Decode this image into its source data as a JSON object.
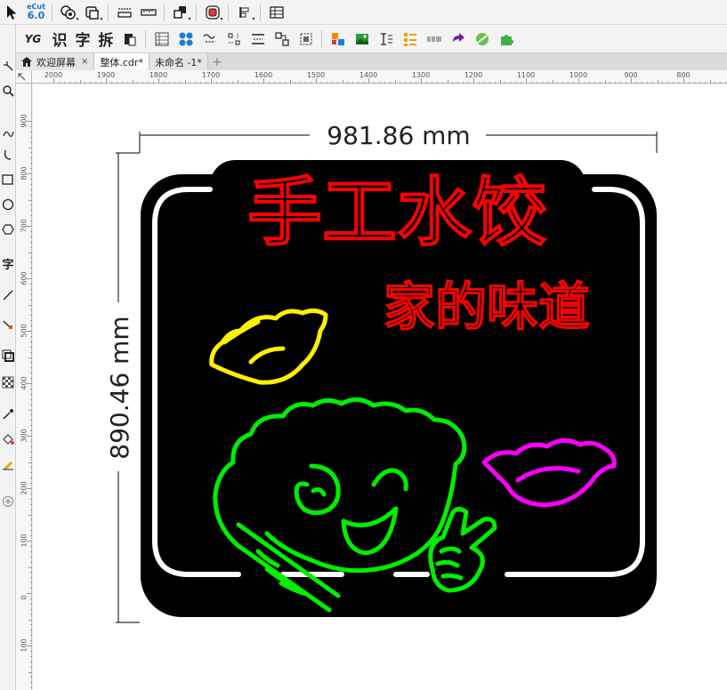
{
  "top_toolbar": {
    "ecut_brand": "eCut",
    "ecut_version": "6.0"
  },
  "second_toolbar": {
    "yg_label": "YG",
    "identify_label": "识",
    "char_label": "字",
    "split_label": "拆"
  },
  "tabs": [
    {
      "label": "欢迎屏幕",
      "close": "×"
    },
    {
      "label": "整体.cdr*"
    },
    {
      "label": "未命名 -1*"
    }
  ],
  "tab_add_symbol": "+",
  "toolbox": {
    "text_tool_label": "字"
  },
  "ruler": {
    "horizontal": [
      "2000",
      "1900",
      "1800",
      "1700",
      "1600",
      "1500",
      "1400",
      "1300",
      "1200",
      "1100",
      "1000",
      "900",
      "800"
    ],
    "vertical": [
      "900",
      "800",
      "700",
      "600",
      "500",
      "400",
      "300",
      "200",
      "100",
      "0",
      "100",
      "200",
      "300",
      "400"
    ]
  },
  "design": {
    "title_main": "手工水饺",
    "title_sub": "家的味道",
    "width_dimension": "981.86 mm",
    "height_dimension": "890.46 mm",
    "colors": {
      "title_main": "#ff0000",
      "title_sub": "#ff0000",
      "yellow_dumpling": "#ffef00",
      "green_mascot": "#00ee00",
      "magenta_dumpling": "#ff00ff",
      "board_background": "#000000",
      "board_inner_outline": "#ffffff"
    }
  }
}
